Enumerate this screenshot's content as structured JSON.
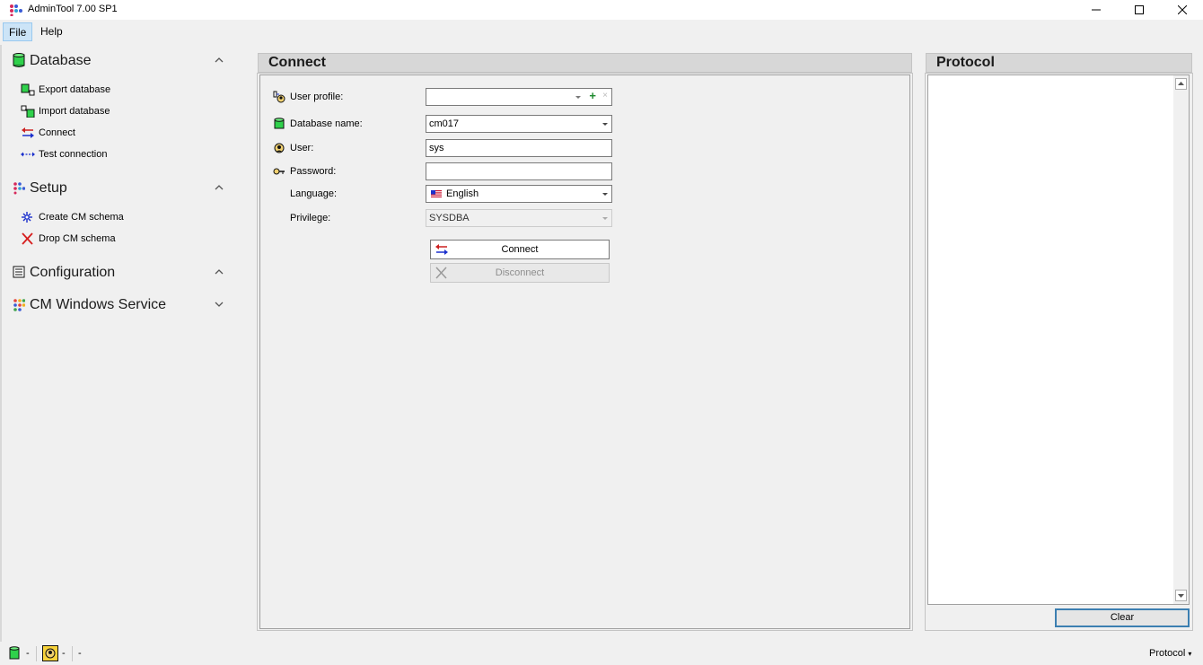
{
  "window": {
    "title": "AdminTool 7.00 SP1",
    "controls": {
      "minimize": "minimize-icon",
      "maximize": "maximize-icon",
      "close": "close-icon"
    }
  },
  "menu": {
    "file": "File",
    "help": "Help"
  },
  "sidebar": {
    "groups": [
      {
        "label": "Database",
        "icon": "database-icon",
        "expanded": true,
        "items": [
          {
            "label": "Export database",
            "icon": "export-database-icon"
          },
          {
            "label": "Import database",
            "icon": "import-database-icon"
          },
          {
            "label": "Connect",
            "icon": "connect-icon"
          },
          {
            "label": "Test connection",
            "icon": "test-connection-icon"
          }
        ]
      },
      {
        "label": "Setup",
        "icon": "setup-icon",
        "expanded": true,
        "items": [
          {
            "label": "Create CM schema",
            "icon": "create-schema-icon"
          },
          {
            "label": "Drop CM schema",
            "icon": "drop-schema-icon"
          }
        ]
      },
      {
        "label": "Configuration",
        "icon": "configuration-icon",
        "expanded": true,
        "items": []
      },
      {
        "label": "CM Windows Service",
        "icon": "windows-service-icon",
        "expanded": false,
        "items": []
      }
    ]
  },
  "connect": {
    "title": "Connect",
    "user_profile": {
      "label": "User profile:",
      "value": ""
    },
    "database_name": {
      "label": "Database name:",
      "value": "cm017"
    },
    "user": {
      "label": "User:",
      "value": "sys"
    },
    "password": {
      "label": "Password:",
      "value": ""
    },
    "language": {
      "label": "Language:",
      "value": "English"
    },
    "privilege": {
      "label": "Privilege:",
      "value": "SYSDBA"
    },
    "connect_button": "Connect",
    "disconnect_button": "Disconnect"
  },
  "protocol": {
    "title": "Protocol",
    "clear_button": "Clear"
  },
  "statusbar": {
    "db_status": "-",
    "user_status": "-",
    "extra": "-",
    "protocol": "Protocol"
  },
  "colors": {
    "accent": "#3c7fb1",
    "db_green": "#2fd14b",
    "connect_red": "#cc2020",
    "connect_blue": "#1a2fcc"
  }
}
